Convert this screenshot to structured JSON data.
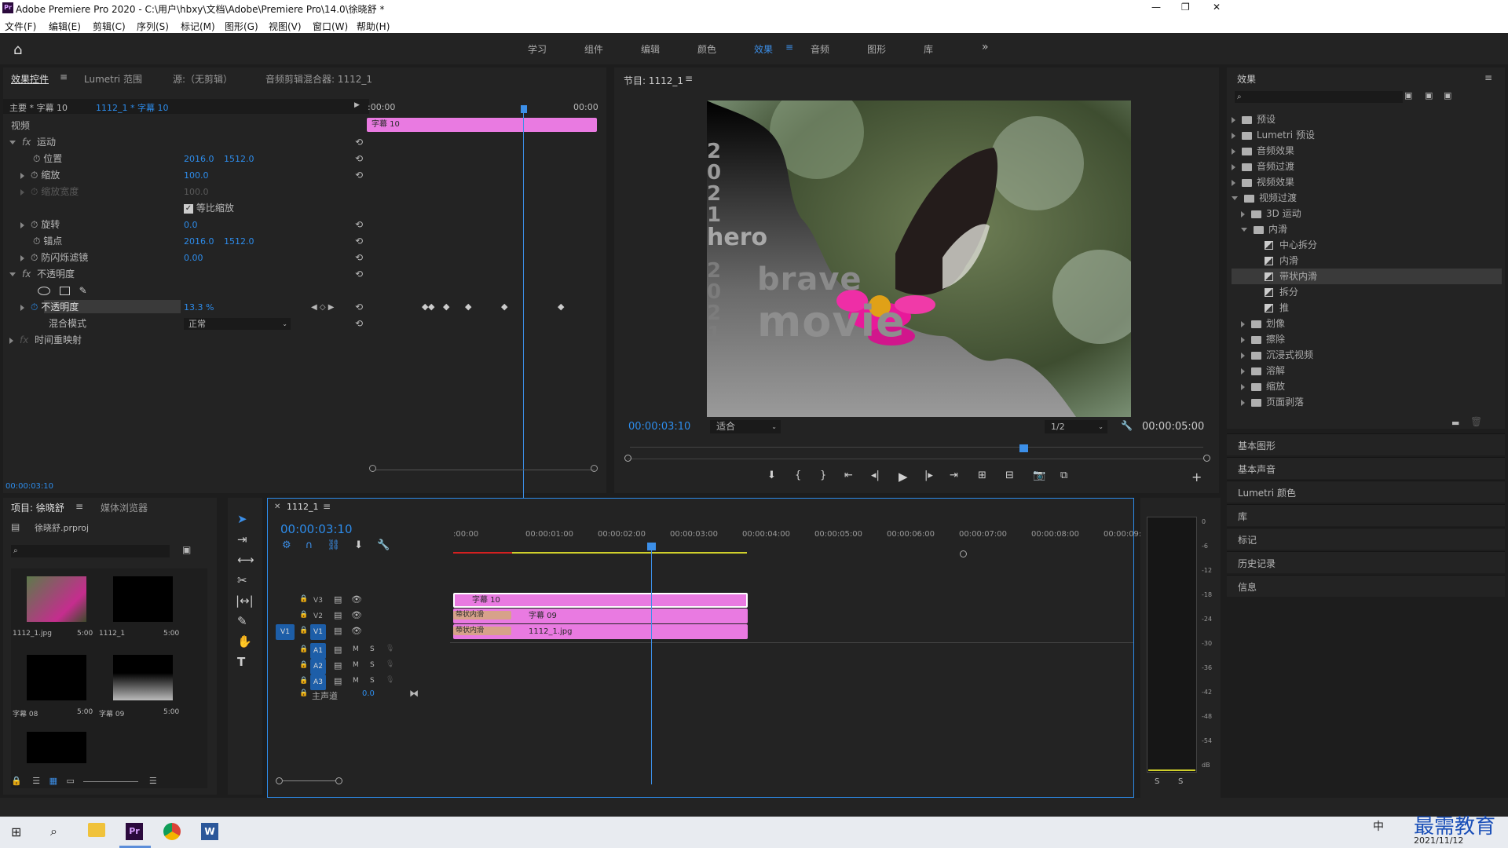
{
  "window": {
    "title": "Adobe Premiere Pro 2020 - C:\\用户\\hbxy\\文档\\Adobe\\Premiere Pro\\14.0\\徐晓舒 *",
    "app_icon": "Pr",
    "controls": [
      "—",
      "❐",
      "✕"
    ]
  },
  "menu": [
    "文件(F)",
    "编辑(E)",
    "剪辑(C)",
    "序列(S)",
    "标记(M)",
    "图形(G)",
    "视图(V)",
    "窗口(W)",
    "帮助(H)"
  ],
  "workspaces": [
    "学习",
    "组件",
    "编辑",
    "颜色",
    "效果",
    "音频",
    "图形",
    "库"
  ],
  "workspace_active": "效果",
  "effect_controls": {
    "tabs": [
      "效果控件",
      "Lumetri 范围",
      "源:（无剪辑）",
      "音频剪辑混合器: 1112_1"
    ],
    "master": "主要 * 字幕 10",
    "seq": "1112_1 * 字幕 10",
    "ruler_start": ":00:00",
    "ruler_end": "00:00",
    "clip_label": "字幕 10",
    "video": "视频",
    "motion": "运动",
    "position": {
      "label": "位置",
      "x": "2016.0",
      "y": "1512.0"
    },
    "scale": {
      "label": "缩放",
      "value": "100.0"
    },
    "scale_width": {
      "label": "缩放宽度",
      "value": "100.0"
    },
    "uniform": "等比缩放",
    "rotation": {
      "label": "旋转",
      "value": "0.0"
    },
    "anchor": {
      "label": "锚点",
      "x": "2016.0",
      "y": "1512.0"
    },
    "flicker": {
      "label": "防闪烁滤镜",
      "value": "0.00"
    },
    "opacity_group": "不透明度",
    "opacity": {
      "label": "不透明度",
      "value": "13.3 %"
    },
    "blend": {
      "label": "混合模式",
      "value": "正常"
    },
    "remap": "时间重映射",
    "timecode": "00:00:03:10"
  },
  "program": {
    "title": "节目: 1112_1",
    "timecode": "00:00:03:10",
    "fit": "适合",
    "res": "1/2",
    "duration": "00:00:05:00",
    "overlay_year1": "2021",
    "overlay_hero": "hero",
    "overlay_year2": "2021",
    "overlay_brave": "brave",
    "overlay_movie": "movie"
  },
  "effects": {
    "title": "效果",
    "tree": [
      {
        "label": "预设",
        "depth": 0,
        "open": false
      },
      {
        "label": "Lumetri 预设",
        "depth": 0,
        "open": false
      },
      {
        "label": "音频效果",
        "depth": 0,
        "open": false
      },
      {
        "label": "音频过渡",
        "depth": 0,
        "open": false
      },
      {
        "label": "视频效果",
        "depth": 0,
        "open": false
      },
      {
        "label": "视频过渡",
        "depth": 0,
        "open": true
      },
      {
        "label": "3D 运动",
        "depth": 1,
        "open": false
      },
      {
        "label": "内滑",
        "depth": 1,
        "open": true
      },
      {
        "label": "中心拆分",
        "depth": 2,
        "item": true
      },
      {
        "label": "内滑",
        "depth": 2,
        "item": true
      },
      {
        "label": "带状内滑",
        "depth": 2,
        "item": true,
        "selected": true
      },
      {
        "label": "拆分",
        "depth": 2,
        "item": true
      },
      {
        "label": "推",
        "depth": 2,
        "item": true
      },
      {
        "label": "划像",
        "depth": 1,
        "open": false
      },
      {
        "label": "擦除",
        "depth": 1,
        "open": false
      },
      {
        "label": "沉浸式视频",
        "depth": 1,
        "open": false
      },
      {
        "label": "溶解",
        "depth": 1,
        "open": false
      },
      {
        "label": "缩放",
        "depth": 1,
        "open": false
      },
      {
        "label": "页面剥落",
        "depth": 1,
        "open": false
      }
    ],
    "panels": [
      "基本图形",
      "基本声音",
      "Lumetri 颜色",
      "库",
      "标记",
      "历史记录",
      "信息"
    ]
  },
  "project": {
    "tabs": [
      "项目: 徐晓舒",
      "媒体浏览器"
    ],
    "file": "徐晓舒.prproj",
    "items": [
      {
        "name": "1112_1.jpg",
        "dur": "5:00"
      },
      {
        "name": "1112_1",
        "dur": "5:00"
      },
      {
        "name": "字幕 08",
        "dur": "5:00"
      },
      {
        "name": "字幕 09",
        "dur": "5:00"
      }
    ]
  },
  "timeline": {
    "tab": "1112_1",
    "timecode": "00:00:03:10",
    "ticks": [
      ":00:00",
      "00:00:01:00",
      "00:00:02:00",
      "00:00:03:00",
      "00:00:04:00",
      "00:00:05:00",
      "00:00:06:00",
      "00:00:07:00",
      "00:00:08:00",
      "00:00:09:"
    ],
    "video_tracks": [
      "V3",
      "V2",
      "V1"
    ],
    "audio_tracks": [
      "A1",
      "A2",
      "A3"
    ],
    "src_patch": "V1",
    "master": "主声道",
    "master_val": "0.0",
    "clips": {
      "v3": "字幕 10",
      "v2_trans": "带状内滑",
      "v2": "字幕 09",
      "v1_trans": "带状内滑",
      "v1": "1112_1.jpg"
    },
    "m": "M",
    "s": "S"
  },
  "meter": {
    "scale": [
      "0",
      "-6",
      "-12",
      "-18",
      "-24",
      "-30",
      "-36",
      "-42",
      "-48",
      "-54",
      "dB"
    ],
    "solo": [
      "S",
      "S"
    ]
  },
  "taskbar": {
    "date": "2021/11/12",
    "watermark": "最需教育",
    "ime": "中"
  }
}
